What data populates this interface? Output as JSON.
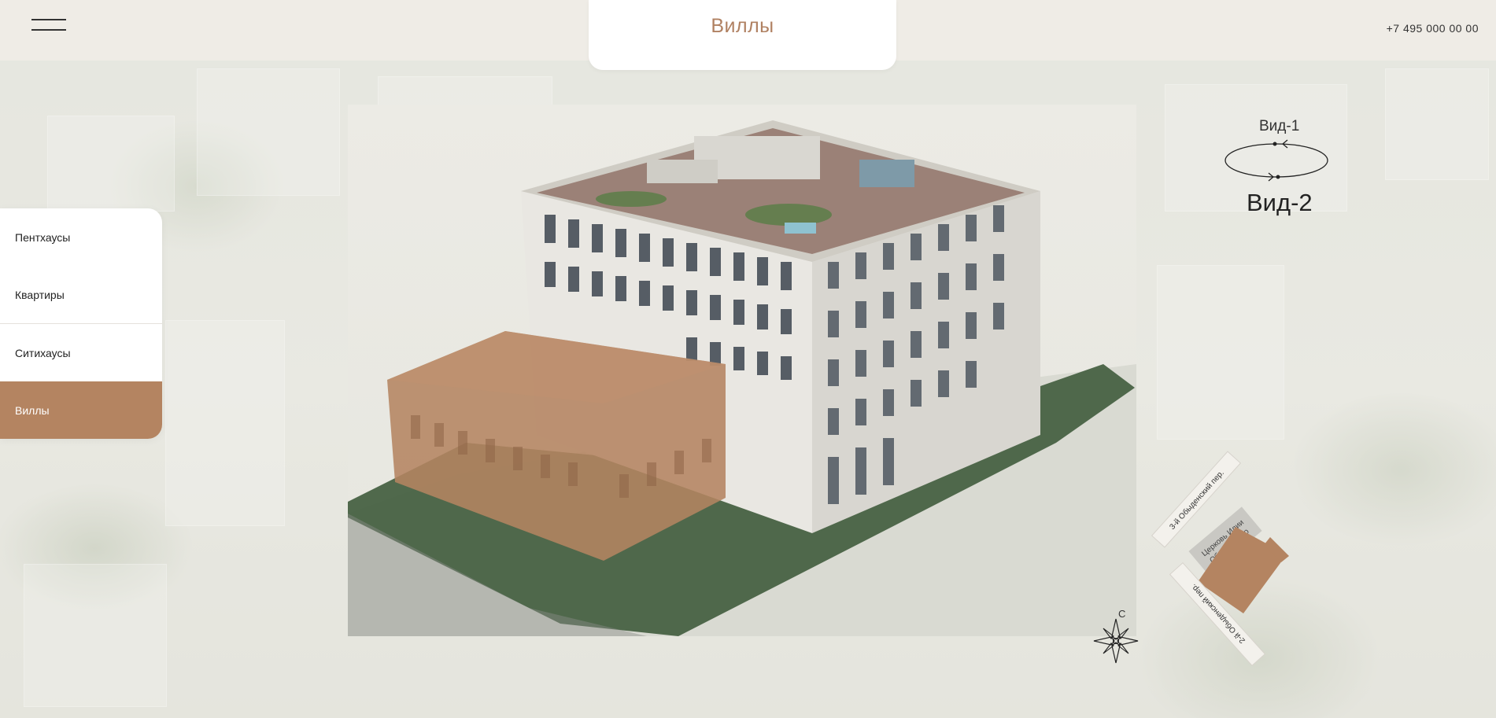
{
  "header": {
    "title": "Виллы",
    "phone": "+7 495 000 00 00"
  },
  "menu": {
    "items": [
      {
        "label": "Пентхаусы",
        "active": false
      },
      {
        "label": "Квартиры",
        "active": false
      },
      {
        "label": "Ситихаусы",
        "active": false
      },
      {
        "label": "Виллы",
        "active": true
      }
    ]
  },
  "views": {
    "other": "Вид-1",
    "current": "Вид-2"
  },
  "map": {
    "street_top": "3-й Обыденский пер.",
    "street_bottom": "2-й Обыденский пер.",
    "church": "Церковь Илии Обыденского",
    "compass_north": "С"
  },
  "colors": {
    "accent": "#b48461",
    "title_text": "#b08162",
    "header_bg": "#efece6",
    "panel_bg": "#ffffff"
  }
}
